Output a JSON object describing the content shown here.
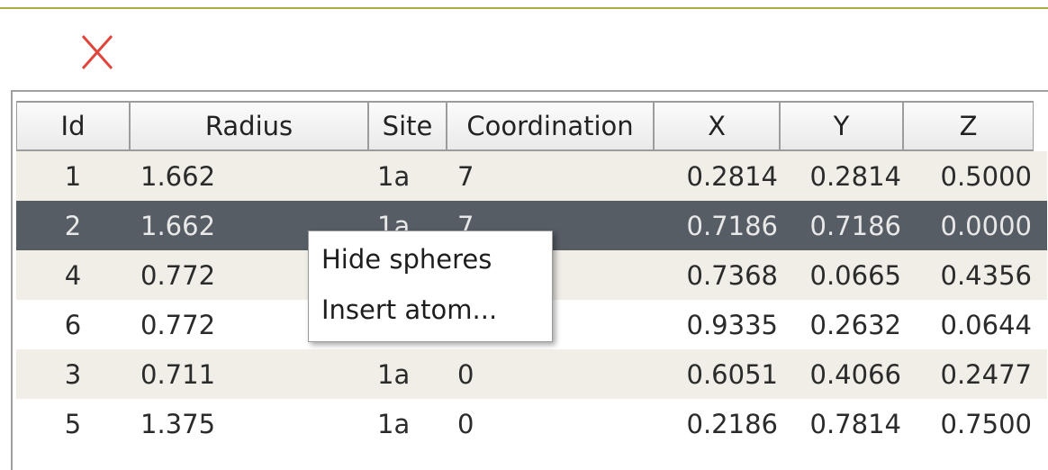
{
  "toolbar": {
    "close_icon": "close-icon",
    "close_color": "#e0453c"
  },
  "table": {
    "columns": [
      "Id",
      "Radius",
      "Site",
      "Coordination",
      "X",
      "Y",
      "Z"
    ],
    "rows": [
      {
        "id": "1",
        "radius": "1.662",
        "site": "1a",
        "coordination": "7",
        "x": "0.2814",
        "y": "0.2814",
        "z": "0.5000"
      },
      {
        "id": "2",
        "radius": "1.662",
        "site": "1a",
        "coordination": "7",
        "x": "0.7186",
        "y": "0.7186",
        "z": "0.0000"
      },
      {
        "id": "4",
        "radius": "0.772",
        "site": "",
        "coordination": "",
        "x": "0.7368",
        "y": "0.0665",
        "z": "0.4356"
      },
      {
        "id": "6",
        "radius": "0.772",
        "site": "",
        "coordination": "",
        "x": "0.9335",
        "y": "0.2632",
        "z": "0.0644"
      },
      {
        "id": "3",
        "radius": "0.711",
        "site": "1a",
        "coordination": "0",
        "x": "0.6051",
        "y": "0.4066",
        "z": "0.2477"
      },
      {
        "id": "5",
        "radius": "1.375",
        "site": "1a",
        "coordination": "0",
        "x": "0.2186",
        "y": "0.7814",
        "z": "0.7500"
      }
    ],
    "selected_row_id": "2"
  },
  "context_menu": {
    "items": [
      "Hide spheres",
      "Insert atom..."
    ]
  },
  "colors": {
    "accent_border": "#a9ad45",
    "row_alt": "#f1eee7",
    "row_selected": "#565d64"
  }
}
